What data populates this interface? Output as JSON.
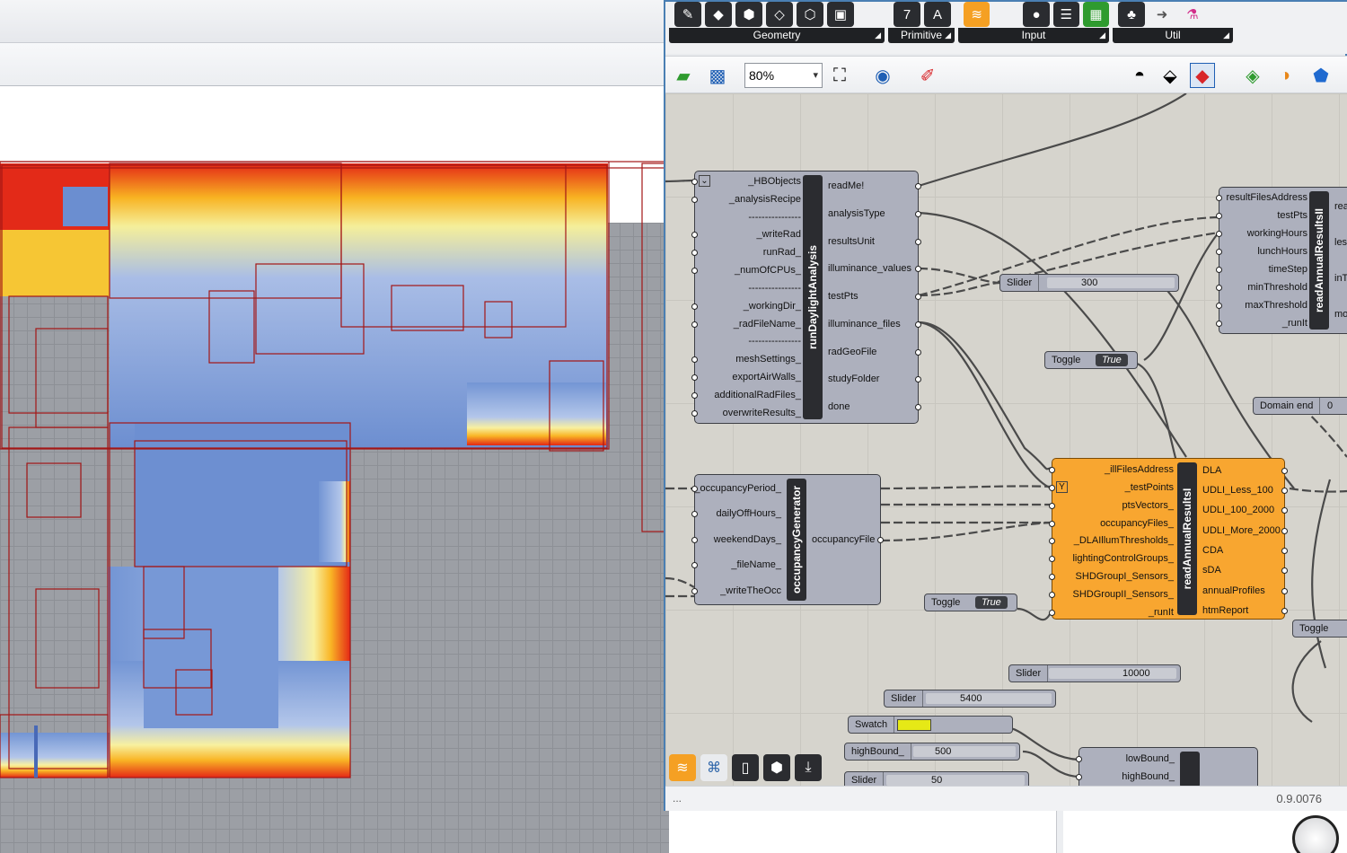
{
  "tabs": {
    "geometry": "Geometry",
    "primitive": "Primitive",
    "input": "Input",
    "util": "Util"
  },
  "toolbar": {
    "zoom": "80%"
  },
  "components": {
    "runDaylight": {
      "title": "runDaylightAnalysis",
      "inputs": [
        "_HBObjects",
        "_analysisRecipe",
        "----------------",
        "_writeRad",
        "runRad_",
        "_numOfCPUs_",
        "----------------",
        "_workingDir_",
        "_radFileName_",
        "----------------",
        "meshSettings_",
        "exportAirWalls_",
        "additionalRadFiles_",
        "overwriteResults_"
      ],
      "outputs": [
        "readMe!",
        "analysisType",
        "resultsUnit",
        "illuminance_values",
        "testPts",
        "illuminance_files",
        "radGeoFile",
        "studyFolder",
        "done"
      ]
    },
    "occupancy": {
      "title": "occupancyGenerator",
      "inputs": [
        "_occupancyPeriod_",
        "dailyOffHours_",
        "weekendDays_",
        "_fileName_",
        "_writeTheOcc"
      ],
      "outputs": [
        "occupancyFile"
      ]
    },
    "annualResults": {
      "title": "readAnnualResultsI",
      "inputs": [
        "_illFilesAddress",
        "_testPoints",
        "ptsVectors_",
        "occupancyFiles_",
        "_DLAIllumThresholds_",
        "lightingControlGroups_",
        "SHDGroupI_Sensors_",
        "SHDGroupII_Sensors_",
        "_runIt"
      ],
      "outputs": [
        "DLA",
        "UDLI_Less_100",
        "UDLI_100_2000",
        "UDLI_More_2000",
        "CDA",
        "sDA",
        "annualProfiles",
        "htmReport"
      ]
    },
    "annualResultsII": {
      "title": "readAnnualResultsII",
      "inputs": [
        "resultFilesAddress",
        "testPts",
        "workingHours",
        "lunchHours",
        "timeStep",
        "minThreshold",
        "maxThreshold",
        "_runIt"
      ],
      "outputs": [
        "read",
        "less",
        "inTh",
        "mor"
      ]
    },
    "bounds": {
      "inputs": [
        "lowBound_",
        "highBound_"
      ]
    }
  },
  "widgets": {
    "slider300": {
      "label": "Slider",
      "value": "300"
    },
    "toggle1": {
      "label": "Toggle",
      "value": "True"
    },
    "domainEnd": {
      "label": "Domain end",
      "value": "0"
    },
    "toggle2": {
      "label": "Toggle",
      "value": "True"
    },
    "toggle3": {
      "label": "Toggle"
    },
    "slider10000": {
      "label": "Slider",
      "value": "10000"
    },
    "slider5400": {
      "label": "Slider",
      "value": "5400"
    },
    "swatch": {
      "label": "Swatch"
    },
    "highBound": {
      "label": "highBound_",
      "value": "500"
    },
    "slider50": {
      "label": "Slider",
      "value": "50"
    }
  },
  "status": {
    "left": "...",
    "version": "0.9.0076"
  },
  "colors": {
    "component": "#adb0bd",
    "component_active": "#f8a630",
    "canvas": "#d6d4cd",
    "window_border": "#4a7fb3",
    "swatch": "#e6e916"
  },
  "icons": {
    "bottom": [
      "ladybug-icon",
      "python-icon",
      "panel-icon",
      "hexagon-icon",
      "download-icon"
    ]
  }
}
